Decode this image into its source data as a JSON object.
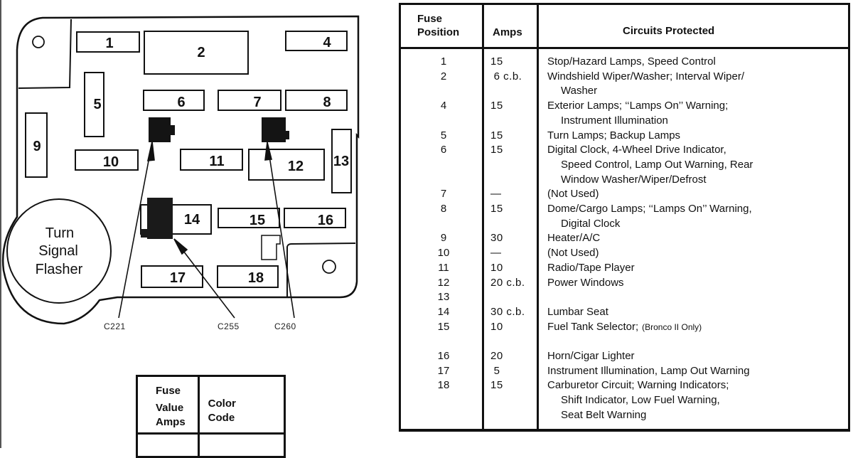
{
  "diagram": {
    "fuse_slots": [
      "1",
      "2",
      "4",
      "5",
      "6",
      "7",
      "8",
      "9",
      "10",
      "11",
      "12",
      "13",
      "14",
      "15",
      "16",
      "17",
      "18"
    ],
    "flasher_label": [
      "Turn",
      "Signal",
      "Flasher"
    ],
    "connectors": [
      "C221",
      "C255",
      "C260"
    ]
  },
  "color_code_table": {
    "headers": {
      "fuse_value": [
        "Fuse",
        "Value",
        "Amps"
      ],
      "color_code": [
        "Color",
        "Code"
      ]
    }
  },
  "fuse_table": {
    "headers": {
      "position": [
        "Fuse",
        "Position"
      ],
      "amps": "Amps",
      "circuits": "Circuits Protected"
    },
    "rows": [
      {
        "position": "1",
        "amps": "15",
        "circuits": [
          "Stop/Hazard Lamps, Speed Control"
        ]
      },
      {
        "position": "2",
        "amps": " 6 c.b.",
        "circuits": [
          "Windshield Wiper/Washer; Interval Wiper/",
          "Washer"
        ]
      },
      {
        "position": "4",
        "amps": "15",
        "circuits": [
          "Exterior Lamps; ‘‘Lamps On’’ Warning;",
          "Instrument Illumination"
        ]
      },
      {
        "position": "5",
        "amps": "15",
        "circuits": [
          "Turn Lamps; Backup Lamps"
        ]
      },
      {
        "position": "6",
        "amps": "15",
        "circuits": [
          "Digital Clock, 4-Wheel Drive Indicator,",
          "Speed Control, Lamp Out Warning, Rear",
          "Window Washer/Wiper/Defrost"
        ]
      },
      {
        "position": "7",
        "amps": "—",
        "circuits": [
          "(Not Used)"
        ]
      },
      {
        "position": "8",
        "amps": "15",
        "circuits": [
          "Dome/Cargo Lamps; ‘‘Lamps On’’ Warning,",
          "Digital Clock"
        ]
      },
      {
        "position": "9",
        "amps": "30",
        "circuits": [
          "Heater/A/C"
        ]
      },
      {
        "position": "10",
        "amps": "—",
        "circuits": [
          "(Not Used)"
        ]
      },
      {
        "position": "11",
        "amps": "10",
        "circuits": [
          "Radio/Tape Player"
        ]
      },
      {
        "position": "12",
        "amps": "20 c.b.",
        "circuits": [
          "Power Windows"
        ]
      },
      {
        "position": "13",
        "amps": "",
        "circuits": []
      },
      {
        "position": "14",
        "amps": "30 c.b.",
        "circuits": [
          "Lumbar Seat"
        ]
      },
      {
        "position": "15",
        "amps": "10",
        "circuits": [
          "Fuel Tank Selector;"
        ],
        "note": "(Bronco II Only)"
      },
      {
        "position": "16",
        "amps": "20",
        "circuits": [
          "Horn/Cigar Lighter"
        ]
      },
      {
        "position": "17",
        "amps": " 5",
        "circuits": [
          "Instrument Illumination, Lamp Out Warning"
        ]
      },
      {
        "position": "18",
        "amps": "15",
        "circuits": [
          "Carburetor Circuit; Warning Indicators;",
          "Shift Indicator, Low Fuel Warning,",
          "Seat Belt Warning"
        ]
      }
    ]
  }
}
